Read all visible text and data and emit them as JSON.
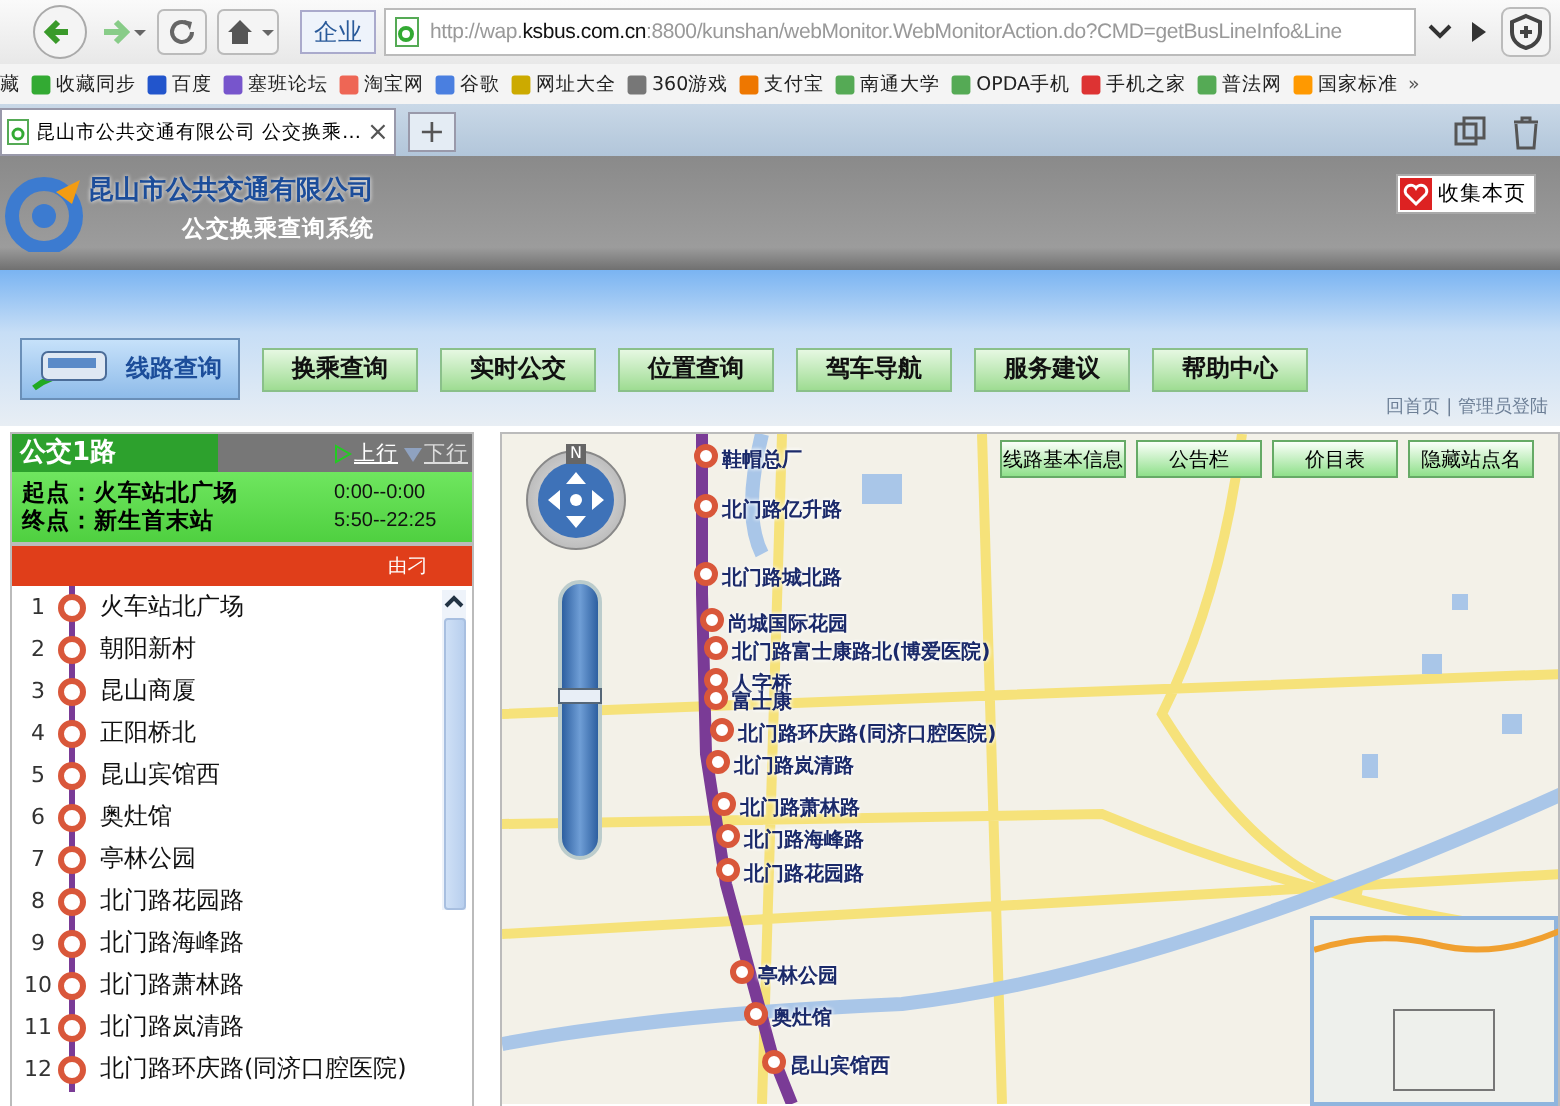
{
  "browser": {
    "search_engine": "企业",
    "url": {
      "prefix": "http://wap.",
      "domain": "ksbus.com.cn",
      "rest": ":8800/kunshan/webMonitor.WebMonitorAction.do?CMD=getBusLineInfo&Line"
    },
    "bookmarks_folder": "藏",
    "bookmarks": [
      {
        "label": "收藏同步"
      },
      {
        "label": "百度"
      },
      {
        "label": "塞班论坛"
      },
      {
        "label": "淘宝网"
      },
      {
        "label": "谷歌"
      },
      {
        "label": "网址大全"
      },
      {
        "label": "360游戏"
      },
      {
        "label": "支付宝"
      },
      {
        "label": "南通大学"
      },
      {
        "label": "OPDA手机"
      },
      {
        "label": "手机之家"
      },
      {
        "label": "普法网"
      },
      {
        "label": "国家标准"
      }
    ],
    "more": "»",
    "tabs": [
      {
        "title": "昆山市公共交通有限公司  公交换乘…",
        "close": "×",
        "selected": true
      }
    ],
    "new_tab": "+"
  },
  "header": {
    "company": "昆山市公共交通有限公司",
    "system": "公交换乘查询系统",
    "bookmark_button": "收集本页"
  },
  "nav": [
    {
      "label": "线路查询",
      "selected": true
    },
    {
      "label": "换乘查询",
      "selected": false
    },
    {
      "label": "实时公交",
      "selected": false
    },
    {
      "label": "位置查询",
      "selected": false
    },
    {
      "label": "驾车导航",
      "selected": false
    },
    {
      "label": "服务建议",
      "selected": false
    },
    {
      "label": "帮助中心",
      "selected": false
    }
  ],
  "top_links": "回首页 | 管理员登陆",
  "line_panel": {
    "name": "公交1路",
    "directions": [
      {
        "label": "上行",
        "selected": true
      },
      {
        "label": "下行",
        "selected": false
      }
    ],
    "start_label": "起点：",
    "start": "火车站北广场",
    "start_time": "0:00--0:00",
    "end_label": "终点：",
    "end": "新生首末站",
    "end_time": "5:50--22:25",
    "notice": "由刁",
    "stops": [
      {
        "number": "1",
        "name": "火车站北广场"
      },
      {
        "number": "2",
        "name": "朝阳新村"
      },
      {
        "number": "3",
        "name": "昆山商厦"
      },
      {
        "number": "4",
        "name": "正阳桥北"
      },
      {
        "number": "5",
        "name": "昆山宾馆西"
      },
      {
        "number": "6",
        "name": "奥灶馆"
      },
      {
        "number": "7",
        "name": "亭林公园"
      },
      {
        "number": "8",
        "name": "北门路花园路"
      },
      {
        "number": "9",
        "name": "北门路海峰路"
      },
      {
        "number": "10",
        "name": "北门路萧林路"
      },
      {
        "number": "11",
        "name": "北门路岚清路"
      },
      {
        "number": "12",
        "name": "北门路环庆路(同济口腔医院)"
      }
    ]
  },
  "map": {
    "zoom": {
      "level": 0.59
    },
    "buttons": [
      "线路基本信息",
      "公告栏",
      "价目表",
      "隐藏站点名"
    ],
    "compass": "N",
    "stops": [
      {
        "name": "鞋帽总厂"
      },
      {
        "name": "北门路亿升路"
      },
      {
        "name": "北门路城北路"
      },
      {
        "name": "尚城国际花园"
      },
      {
        "name": "北门路富士康路北(博爱医院)"
      },
      {
        "name": "人字桥"
      },
      {
        "name": "富士康"
      },
      {
        "name": "北门路环庆路(同济口腔医院)"
      },
      {
        "name": "北门路岚清路"
      },
      {
        "name": "北门路萧林路"
      },
      {
        "name": "北门路海峰路"
      },
      {
        "name": "北门路花园路"
      },
      {
        "name": "亭林公园"
      },
      {
        "name": "奥灶馆"
      },
      {
        "name": "昆山宾馆西"
      }
    ]
  }
}
